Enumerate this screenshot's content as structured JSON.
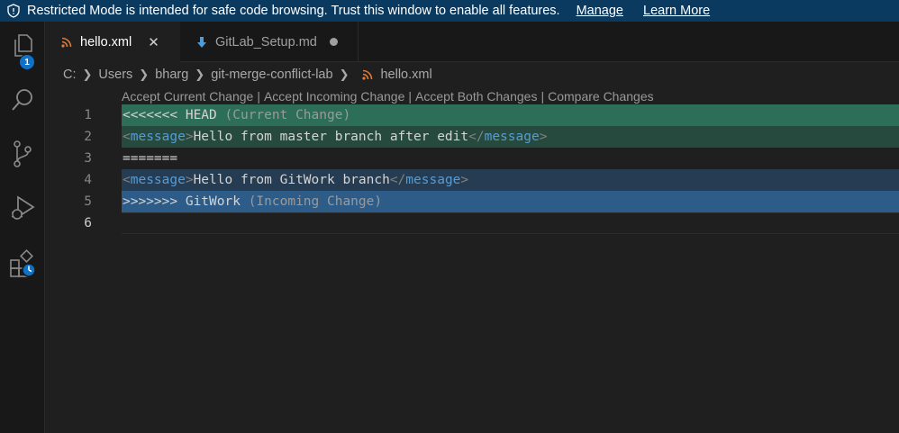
{
  "banner": {
    "message": "Restricted Mode is intended for safe code browsing. Trust this window to enable all features.",
    "manage_label": "Manage",
    "learn_more_label": "Learn More",
    "bg_color": "#0b3a60"
  },
  "activity_bar": {
    "explorer_badge": "1",
    "items": [
      "files-icon",
      "search-icon",
      "source-control-icon",
      "run-debug-icon",
      "extensions-icon"
    ]
  },
  "tabs": [
    {
      "label": "hello.xml",
      "icon": "rss-icon",
      "active": true
    },
    {
      "label": "GitLab_Setup.md",
      "icon": "markdown-download-icon",
      "active": false,
      "modified": true
    }
  ],
  "breadcrumb": {
    "items": [
      "C:",
      "Users",
      "bharg",
      "git-merge-conflict-lab"
    ],
    "file": "hello.xml"
  },
  "codelens": {
    "accept_current": "Accept Current Change",
    "accept_incoming": "Accept Incoming Change",
    "accept_both": "Accept Both Changes",
    "compare": "Compare Changes",
    "separator": "|"
  },
  "editor": {
    "line_numbers": [
      "1",
      "2",
      "3",
      "4",
      "5",
      "6"
    ],
    "line1": {
      "marker": "<<<<<<< HEAD",
      "hint": "(Current Change)"
    },
    "line2": {
      "open_lt": "<",
      "open_tag": "message",
      "open_gt": ">",
      "text": "Hello from master branch after edit",
      "close_lt": "</",
      "close_tag": "message",
      "close_gt": ">"
    },
    "line3": {
      "text": "======="
    },
    "line4": {
      "open_lt": "<",
      "open_tag": "message",
      "open_gt": ">",
      "text": "Hello from GitWork branch",
      "close_lt": "</",
      "close_tag": "message",
      "close_gt": ">"
    },
    "line5": {
      "marker": ">>>>>>> GitWork",
      "hint": "(Incoming Change)"
    }
  },
  "colors": {
    "current_header": "#2d6e58",
    "current_body": "#264a3e",
    "incoming_body": "#253c52",
    "incoming_header": "#2e5c88",
    "xml_tag": "#569cd6"
  }
}
